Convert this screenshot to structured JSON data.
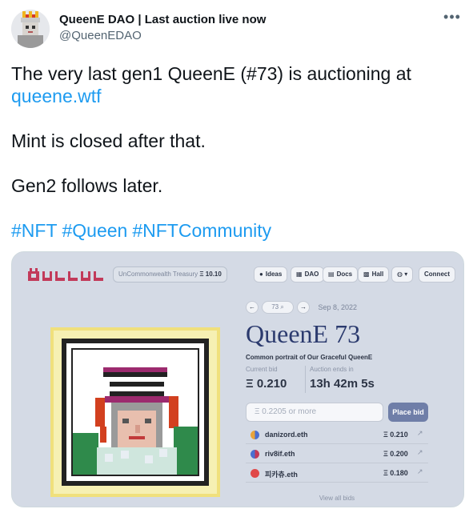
{
  "author": {
    "display_name": "QueenE DAO | Last auction live now",
    "handle": "@QueenEDAO"
  },
  "tweet": {
    "line1": "The very last gen1 QueenE (#73) is auctioning at",
    "link": "queene.wtf",
    "line2": "Mint is closed after that.",
    "line3": "Gen2 follows later.",
    "hashtags": [
      "#NFT",
      "#Queen",
      "#NFTCommunity"
    ]
  },
  "site": {
    "treasury_label": "UnCommonwealth Treasury",
    "treasury_value": "Ξ 10.10",
    "nav": [
      {
        "icon": "lightbulb-icon",
        "label": "Ideas"
      },
      {
        "icon": "dao-icon",
        "label": "DAO"
      },
      {
        "icon": "docs-icon",
        "label": "Docs"
      },
      {
        "icon": "hall-icon",
        "label": "Hall"
      }
    ],
    "connect_label": "Connect",
    "auction": {
      "id_placeholder": "73",
      "date": "Sep 8, 2022",
      "title": "QueenE 73",
      "subtitle": "Common portrait of Our Graceful QueenE",
      "current_bid_label": "Current bid",
      "current_bid": "Ξ 0.210",
      "ends_label": "Auction ends in",
      "ends_value": "13h 42m 5s",
      "bid_placeholder": "Ξ 0.2205 or more",
      "place_bid_label": "Place bid",
      "bids": [
        {
          "bidder": "danizord.eth",
          "amount": "Ξ 0.210",
          "color": "#e8a33c"
        },
        {
          "bidder": "riv8if.eth",
          "amount": "Ξ 0.200",
          "color": "#4a6fd1"
        },
        {
          "bidder": "피카츄.eth",
          "amount": "Ξ 0.180",
          "color": "#e04848"
        }
      ],
      "view_all_label": "View all bids"
    }
  }
}
